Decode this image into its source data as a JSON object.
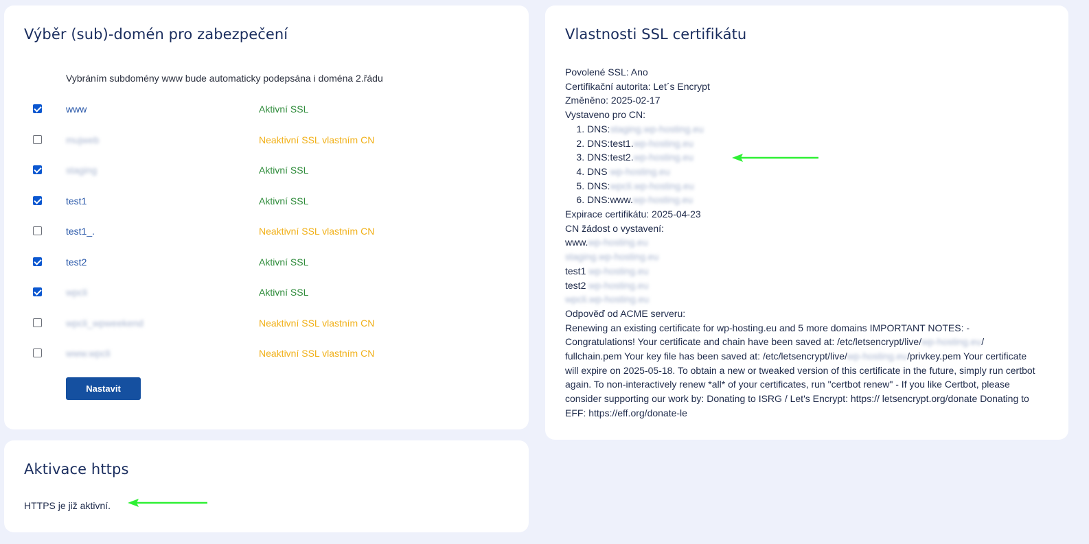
{
  "domains_card": {
    "title": "Výběr (sub)-domén pro zabezpečení",
    "hint": "Vybráním subdomény www bude automaticky podepsána i doména 2.řádu",
    "rows": [
      {
        "name": "www",
        "blurred": false,
        "checked": true,
        "status": "Aktivní SSL",
        "status_kind": "ok"
      },
      {
        "name": "mujweb",
        "blurred": true,
        "checked": false,
        "status": "Neaktivní SSL vlastním CN",
        "status_kind": "warn"
      },
      {
        "name": "staging",
        "blurred": true,
        "checked": true,
        "status": "Aktivní SSL",
        "status_kind": "ok"
      },
      {
        "name": "test1",
        "blurred": false,
        "checked": true,
        "status": "Aktivní SSL",
        "status_kind": "ok"
      },
      {
        "name": "test1_.",
        "blurred": false,
        "checked": false,
        "status": "Neaktivní SSL vlastním CN",
        "status_kind": "warn"
      },
      {
        "name": "test2",
        "blurred": false,
        "checked": true,
        "status": "Aktivní SSL",
        "status_kind": "ok"
      },
      {
        "name": "wpcli",
        "blurred": true,
        "checked": true,
        "status": "Aktivní SSL",
        "status_kind": "ok"
      },
      {
        "name": "wpcli_wpweekend",
        "blurred": true,
        "checked": false,
        "status": "Neaktivní SSL vlastním CN",
        "status_kind": "warn"
      },
      {
        "name": "www.wpcli",
        "blurred": true,
        "checked": false,
        "status": "Neaktivní SSL vlastním CN",
        "status_kind": "warn"
      }
    ],
    "submit_label": "Nastavit"
  },
  "https_card": {
    "title": "Aktivace https",
    "text": "HTTPS je již aktivní."
  },
  "ssl_card": {
    "title": "Vlastnosti SSL certifikátu",
    "enabled": "Povolené SSL: Ano",
    "authority": "Certifikační autorita: Let´s Encrypt",
    "changed": "Změněno: 2025-02-17",
    "issued_for_label": "Vystaveno pro CN:",
    "dns_list": [
      {
        "prefix": "DNS:",
        "blurred": "staging.wp-hosting.eu"
      },
      {
        "prefix": "DNS:test1.",
        "blurred": "wp-hosting.eu"
      },
      {
        "prefix": "DNS:test2.",
        "blurred": "wp-hosting.eu"
      },
      {
        "prefix": "DNS ",
        "blurred": "wp-hosting.eu"
      },
      {
        "prefix": "DNS:",
        "blurred": "wpcli.wp-hosting.eu"
      },
      {
        "prefix": "DNS:www.",
        "blurred": "wp-hosting.eu"
      }
    ],
    "expiry": "Expirace certifikátu: 2025-04-23",
    "cn_request_label": "CN žádost o vystavení:",
    "cn_requests": [
      {
        "prefix": "www.",
        "blurred": "wp-hosting.eu"
      },
      {
        "prefix": "",
        "blurred": "staging.wp-hosting.eu"
      },
      {
        "prefix": "test1 ",
        "blurred": "wp-hosting.eu"
      },
      {
        "prefix": "test2 ",
        "blurred": "wp-hosting.eu"
      },
      {
        "prefix": "",
        "blurred": "wpcli.wp-hosting.eu"
      }
    ],
    "acme_label": "Odpověď od ACME serveru:",
    "acme_part1": "Renewing an existing certificate for wp-hosting.eu and 5 more domains IMPORTANT NOTES: - Congratulations! Your certificate and chain have been saved at: /etc/letsencrypt/live/",
    "acme_blur1": "wp-hosting.eu",
    "acme_part2": "/ fullchain.pem Your key file has been saved at: /etc/letsencrypt/live/",
    "acme_blur2": "wp-hosting.eu",
    "acme_part3": "/privkey.pem Your certificate will expire on 2025-05-18. To obtain a new or tweaked version of this certificate in the future, simply run certbot again. To non-interactively renew *all* of your certificates, run \"certbot renew\" - If you like Certbot, please consider supporting our work by: Donating to ISRG / Let's Encrypt: https:// letsencrypt.org/donate Donating to EFF: https://eff.org/donate-le"
  },
  "colors": {
    "background": "#eef1fb",
    "card": "#ffffff",
    "title": "#1a2d5e",
    "link": "#2756a8",
    "status_ok": "#2e8b3a",
    "status_warn": "#f1b018",
    "checkbox": "#0b57d0",
    "button": "#1550a0",
    "annotation_arrow": "#2ef034"
  }
}
